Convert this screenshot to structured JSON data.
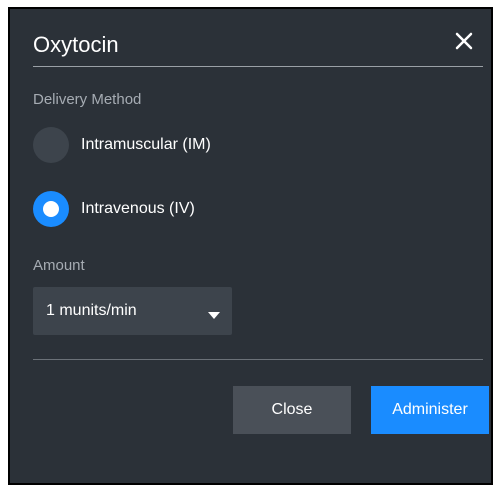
{
  "dialog": {
    "title": "Oxytocin",
    "close_icon": "close-icon"
  },
  "delivery": {
    "label": "Delivery Method",
    "options": [
      {
        "label": "Intramuscular (IM)",
        "selected": false
      },
      {
        "label": "Intravenous (IV)",
        "selected": true
      }
    ]
  },
  "amount": {
    "label": "Amount",
    "selected_value": "1 munits/min",
    "caret_icon": "caret-down-icon"
  },
  "footer": {
    "close_label": "Close",
    "administer_label": "Administer"
  },
  "colors": {
    "background": "#2b3138",
    "accent": "#1a8cff",
    "control": "#3d444c",
    "secondary_button": "#4a5058",
    "muted_text": "#a6acb3"
  }
}
